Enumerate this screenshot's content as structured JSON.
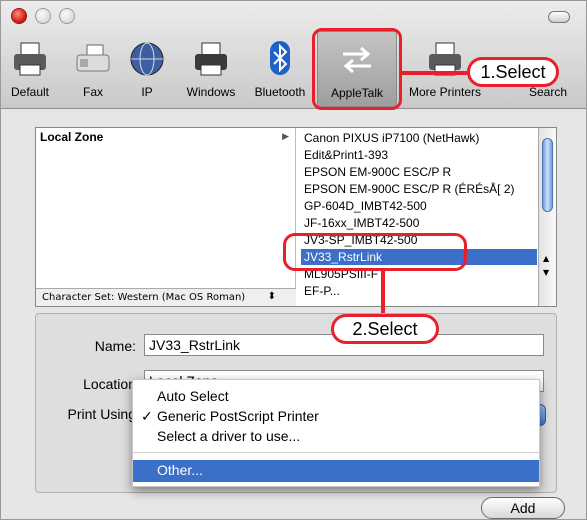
{
  "toolbar": {
    "items": [
      {
        "label": "Default",
        "icon": "printer-icon"
      },
      {
        "label": "Fax",
        "icon": "fax-icon"
      },
      {
        "label": "IP",
        "icon": "globe-icon"
      },
      {
        "label": "Windows",
        "icon": "printer-icon"
      },
      {
        "label": "Bluetooth",
        "icon": "bluetooth-icon"
      },
      {
        "label": "AppleTalk",
        "icon": "arrows-exchange-icon",
        "selected": true
      },
      {
        "label": "More Printers",
        "icon": "printer-icon"
      },
      {
        "label": "Search",
        "icon": "search-icon"
      }
    ]
  },
  "annotations": {
    "step1": "1.Select",
    "step2": "2.Select",
    "accent": "#e8202a"
  },
  "browser": {
    "zone": "Local Zone",
    "charset_label": "Character Set:",
    "charset_value": "Western (Mac OS Roman)",
    "printers": [
      "Canon PIXUS iP7100 (NetHawk)",
      "Edit&Print1-393",
      "EPSON EM-900C ESC/P R",
      "EPSON EM-900C ESC/P R (ÉRÉsÅ[ 2)",
      "GP-604D_IMBT42-500",
      "JF-16xx_IMBT42-500",
      "JV3-SP_IMBT42-500",
      "JV33_RstrLink",
      "ML905PSIII-F",
      "EF-P..."
    ],
    "selected_printer": "JV33_RstrLink",
    "selection_color": "#3b6fc8"
  },
  "form": {
    "name_label": "Name:",
    "name_value": "JV33_RstrLink",
    "location_label": "Location",
    "location_value": "Local Zone",
    "print_using_label": "Print Using"
  },
  "menu": {
    "items": [
      {
        "label": "Auto Select",
        "checked": false
      },
      {
        "label": "Generic PostScript Printer",
        "checked": true
      },
      {
        "label": "Select a driver to use...",
        "checked": false
      },
      {
        "label": "Other...",
        "highlighted": true
      }
    ],
    "check_mark": "✓"
  },
  "buttons": {
    "add": "Add"
  }
}
